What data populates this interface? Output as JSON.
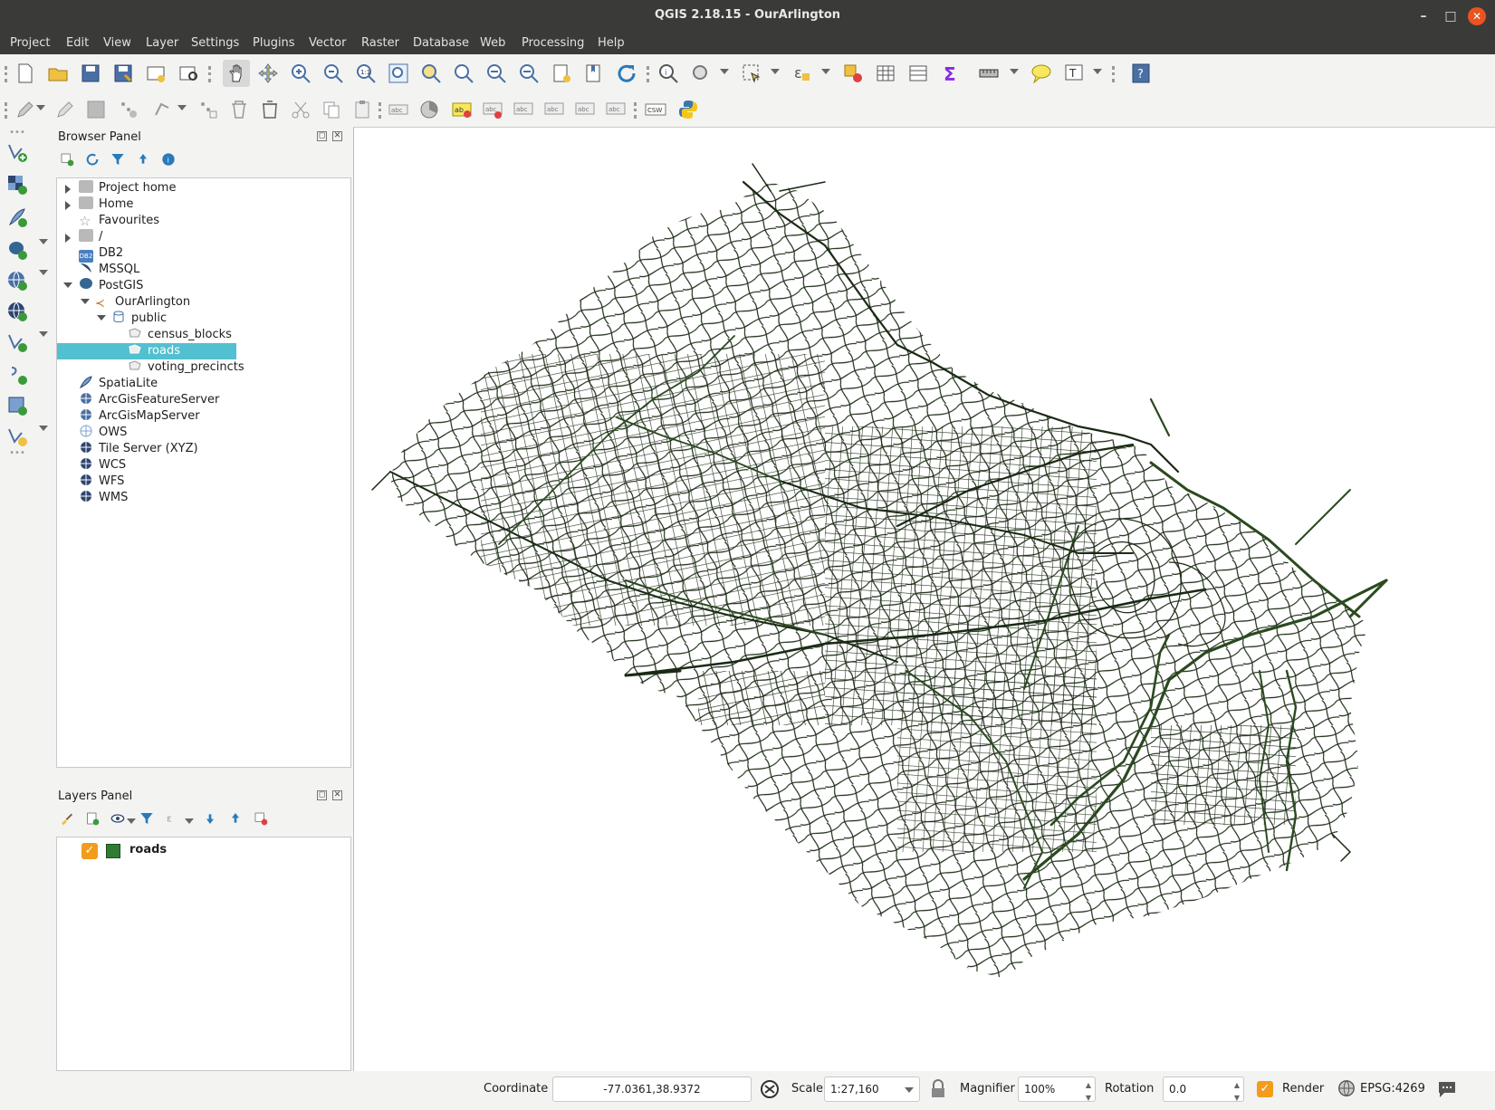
{
  "window": {
    "title": "QGIS 2.18.15 - OurArlington"
  },
  "menu": [
    "Project",
    "Edit",
    "View",
    "Layer",
    "Settings",
    "Plugins",
    "Vector",
    "Raster",
    "Database",
    "Web",
    "Processing",
    "Help"
  ],
  "browser_panel": {
    "title": "Browser Panel",
    "items": [
      {
        "label": "Project home",
        "icon": "folder-icon"
      },
      {
        "label": "Home",
        "icon": "folder-icon"
      },
      {
        "label": "Favourites",
        "icon": "star-icon"
      },
      {
        "label": "/",
        "icon": "folder-icon"
      },
      {
        "label": "DB2",
        "icon": "db2-icon"
      },
      {
        "label": "MSSQL",
        "icon": "mssql-icon"
      },
      {
        "label": "PostGIS",
        "icon": "postgis-elephant-icon"
      },
      {
        "label": "OurArlington",
        "icon": "connection-icon"
      },
      {
        "label": "public",
        "icon": "schema-icon"
      },
      {
        "label": "census_blocks",
        "icon": "polygon-layer-icon"
      },
      {
        "label": "roads",
        "icon": "line-layer-icon"
      },
      {
        "label": "voting_precincts",
        "icon": "polygon-layer-icon"
      },
      {
        "label": "SpatiaLite",
        "icon": "spatialite-feather-icon"
      },
      {
        "label": "ArcGisFeatureServer",
        "icon": "globe-icon"
      },
      {
        "label": "ArcGisMapServer",
        "icon": "globe-icon"
      },
      {
        "label": "OWS",
        "icon": "ows-globe-icon"
      },
      {
        "label": "Tile Server (XYZ)",
        "icon": "globe-icon"
      },
      {
        "label": "WCS",
        "icon": "globe-icon"
      },
      {
        "label": "WFS",
        "icon": "globe-icon"
      },
      {
        "label": "WMS",
        "icon": "globe-icon"
      }
    ],
    "selected": "roads"
  },
  "layers_panel": {
    "title": "Layers Panel",
    "layers": [
      {
        "name": "roads",
        "checked": true,
        "color": "#2e7d32"
      }
    ]
  },
  "statusbar": {
    "coordinate_label": "Coordinate",
    "coordinate_value": "-77.0361,38.9372",
    "scale_label": "Scale",
    "scale_value": "1:27,160",
    "magnifier_label": "Magnifier",
    "magnifier_value": "100%",
    "rotation_label": "Rotation",
    "rotation_value": "0.0",
    "render_label": "Render",
    "render_checked": true,
    "crs": "EPSG:4269"
  },
  "colors": {
    "accent": "#f29c1b",
    "selection": "#52c0d0",
    "road": "#1a2a14",
    "titlebar": "#3a3a38",
    "close": "#e95420"
  }
}
